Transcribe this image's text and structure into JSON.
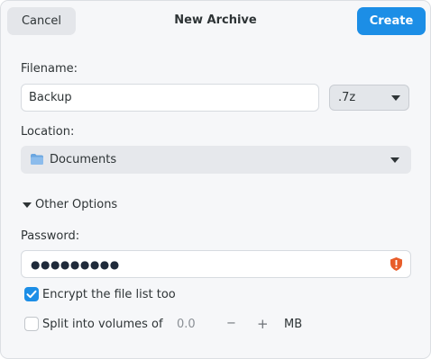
{
  "header": {
    "cancel_label": "Cancel",
    "title": "New Archive",
    "create_label": "Create"
  },
  "filename": {
    "label": "Filename:",
    "value": "Backup",
    "extension": ".7z"
  },
  "location": {
    "label": "Location:",
    "folder": "Documents",
    "folder_icon": "folder-icon"
  },
  "options": {
    "expander_label": "Other Options",
    "password_label": "Password:",
    "password_masked": "●●●●●●●●●",
    "password_warning_icon": "warning-shield-icon",
    "encrypt_label": "Encrypt the file list too",
    "encrypt_checked": true,
    "split_label": "Split into volumes of",
    "split_checked": false,
    "split_value": "0.0",
    "minus": "−",
    "plus": "+",
    "unit": "MB"
  },
  "colors": {
    "accent": "#1c8ee6",
    "warning": "#e85d2a",
    "folder": "#6aa6e0"
  }
}
